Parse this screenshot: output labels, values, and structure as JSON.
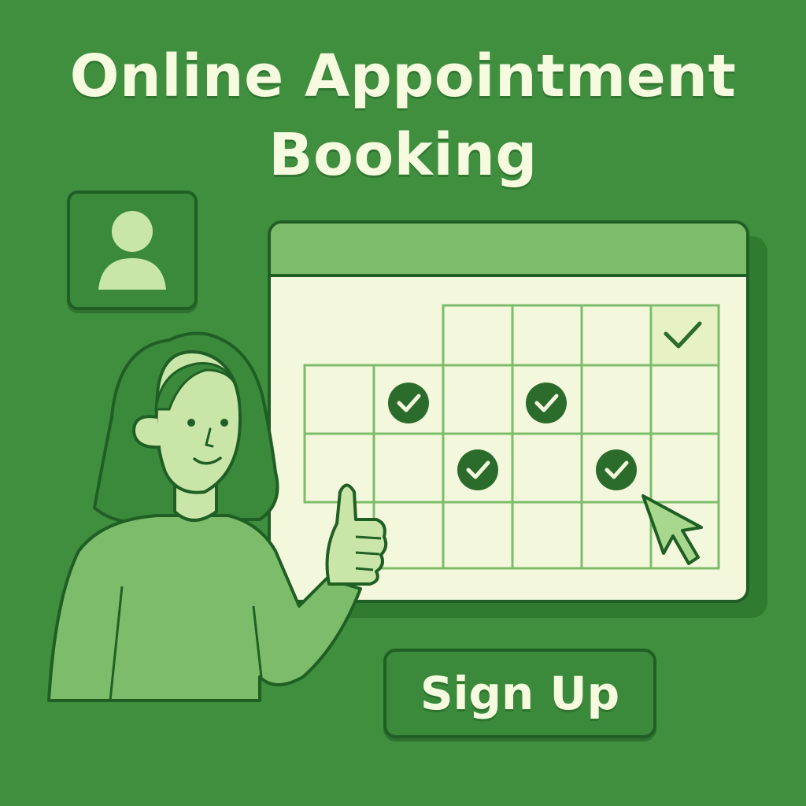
{
  "title": {
    "line1": "Online Appointment",
    "line2": "Booking"
  },
  "signup": {
    "label": "Sign Up"
  },
  "colors": {
    "background": "#3f8f3f",
    "dark_outline": "#1f5f24",
    "light_fill": "#f3f8dc",
    "accent_light_green": "#7cbc6a",
    "title_text": "#f6fbe0",
    "check_circle": "#2b6b2b"
  },
  "icons": {
    "profile": "user-avatar-icon",
    "check": "check-icon",
    "cursor": "mouse-pointer-icon"
  },
  "calendar": {
    "rows": 4,
    "booked_slots": 5
  }
}
